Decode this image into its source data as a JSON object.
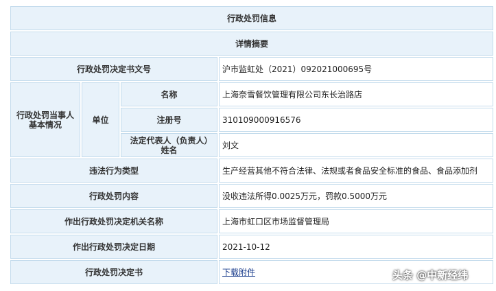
{
  "header": {
    "title": "行政处罚信息",
    "subtitle": "详情摘要"
  },
  "rows": {
    "decision_no": {
      "label": "行政处罚决定书文号",
      "value": "沪市监虹处（2021）092021000695号"
    },
    "party": {
      "label": "行政处罚当事人基本情况",
      "unit_label": "单位",
      "name": {
        "label": "名称",
        "value": "上海奈雪餐饮管理有限公司东长治路店"
      },
      "reg_no": {
        "label": "注册号",
        "value": "310109000916576"
      },
      "legal_rep": {
        "label": "法定代表人（负责人）姓名",
        "value": "刘文"
      }
    },
    "violation_type": {
      "label": "违法行为类型",
      "value": "生产经营其他不符合法律、法规或者食品安全标准的食品、食品添加剂"
    },
    "penalty_content": {
      "label": "行政处罚内容",
      "value": "没收违法所得0.0025万元，罚款0.5000万元"
    },
    "authority": {
      "label": "作出行政处罚决定机关名称",
      "value": "上海市虹口区市场监督管理局"
    },
    "decision_date": {
      "label": "作出行政处罚决定日期",
      "value": "2021-10-12"
    },
    "decision_doc": {
      "label": "行政处罚决定书",
      "value": "下载附件"
    }
  },
  "watermark": "头条 @中新经纬"
}
